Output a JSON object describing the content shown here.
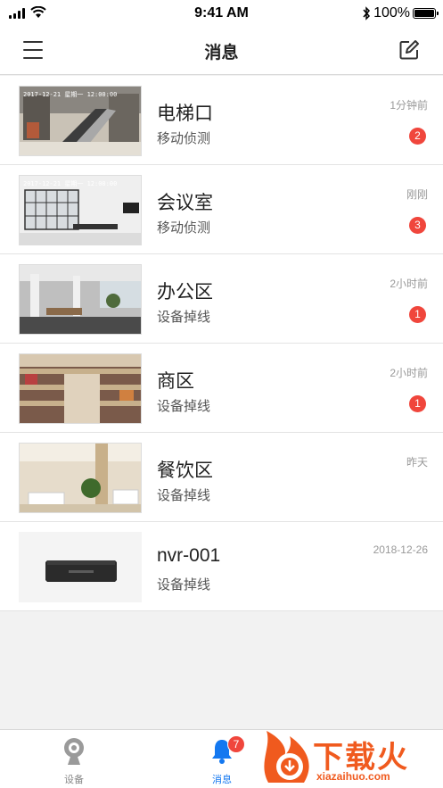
{
  "status_bar": {
    "time": "9:41 AM",
    "battery_percent": "100%",
    "battery_level": 1.0
  },
  "header": {
    "title": "消息"
  },
  "messages": [
    {
      "name": "电梯口",
      "event": "移动侦测",
      "time": "1分钟前",
      "badge": "2",
      "thumb_stamp": "2017-12-21 星期一 12:00:00",
      "thumb_icon": "escalator-mall-image"
    },
    {
      "name": "会议室",
      "event": "移动侦测",
      "time": "刚刚",
      "badge": "3",
      "thumb_stamp": "2017-12-21 星期一 12:00:00",
      "thumb_icon": "meeting-room-image"
    },
    {
      "name": "办公区",
      "event": "设备掉线",
      "time": "2小时前",
      "badge": "1",
      "thumb_stamp": "",
      "thumb_icon": "office-area-image"
    },
    {
      "name": "商区",
      "event": "设备掉线",
      "time": "2小时前",
      "badge": "1",
      "thumb_stamp": "",
      "thumb_icon": "shopping-area-image"
    },
    {
      "name": "餐饮区",
      "event": "设备掉线",
      "time": "昨天",
      "badge": "",
      "thumb_stamp": "",
      "thumb_icon": "dining-area-image"
    },
    {
      "name": "nvr-001",
      "event": "设备掉线",
      "time": "2018-12-26",
      "badge": "",
      "thumb_stamp": "",
      "thumb_icon": "nvr-device-image"
    }
  ],
  "tabs": [
    {
      "label": "设备",
      "icon": "camera-icon",
      "active": false
    },
    {
      "label": "消息",
      "icon": "bell-icon",
      "active": true,
      "badge": "7"
    }
  ],
  "watermark": {
    "text": "下载火",
    "url": "xiazaihuo.com"
  },
  "colors": {
    "accent": "#1478f0",
    "badge": "#f0463c",
    "watermark": "#f05a1e"
  }
}
